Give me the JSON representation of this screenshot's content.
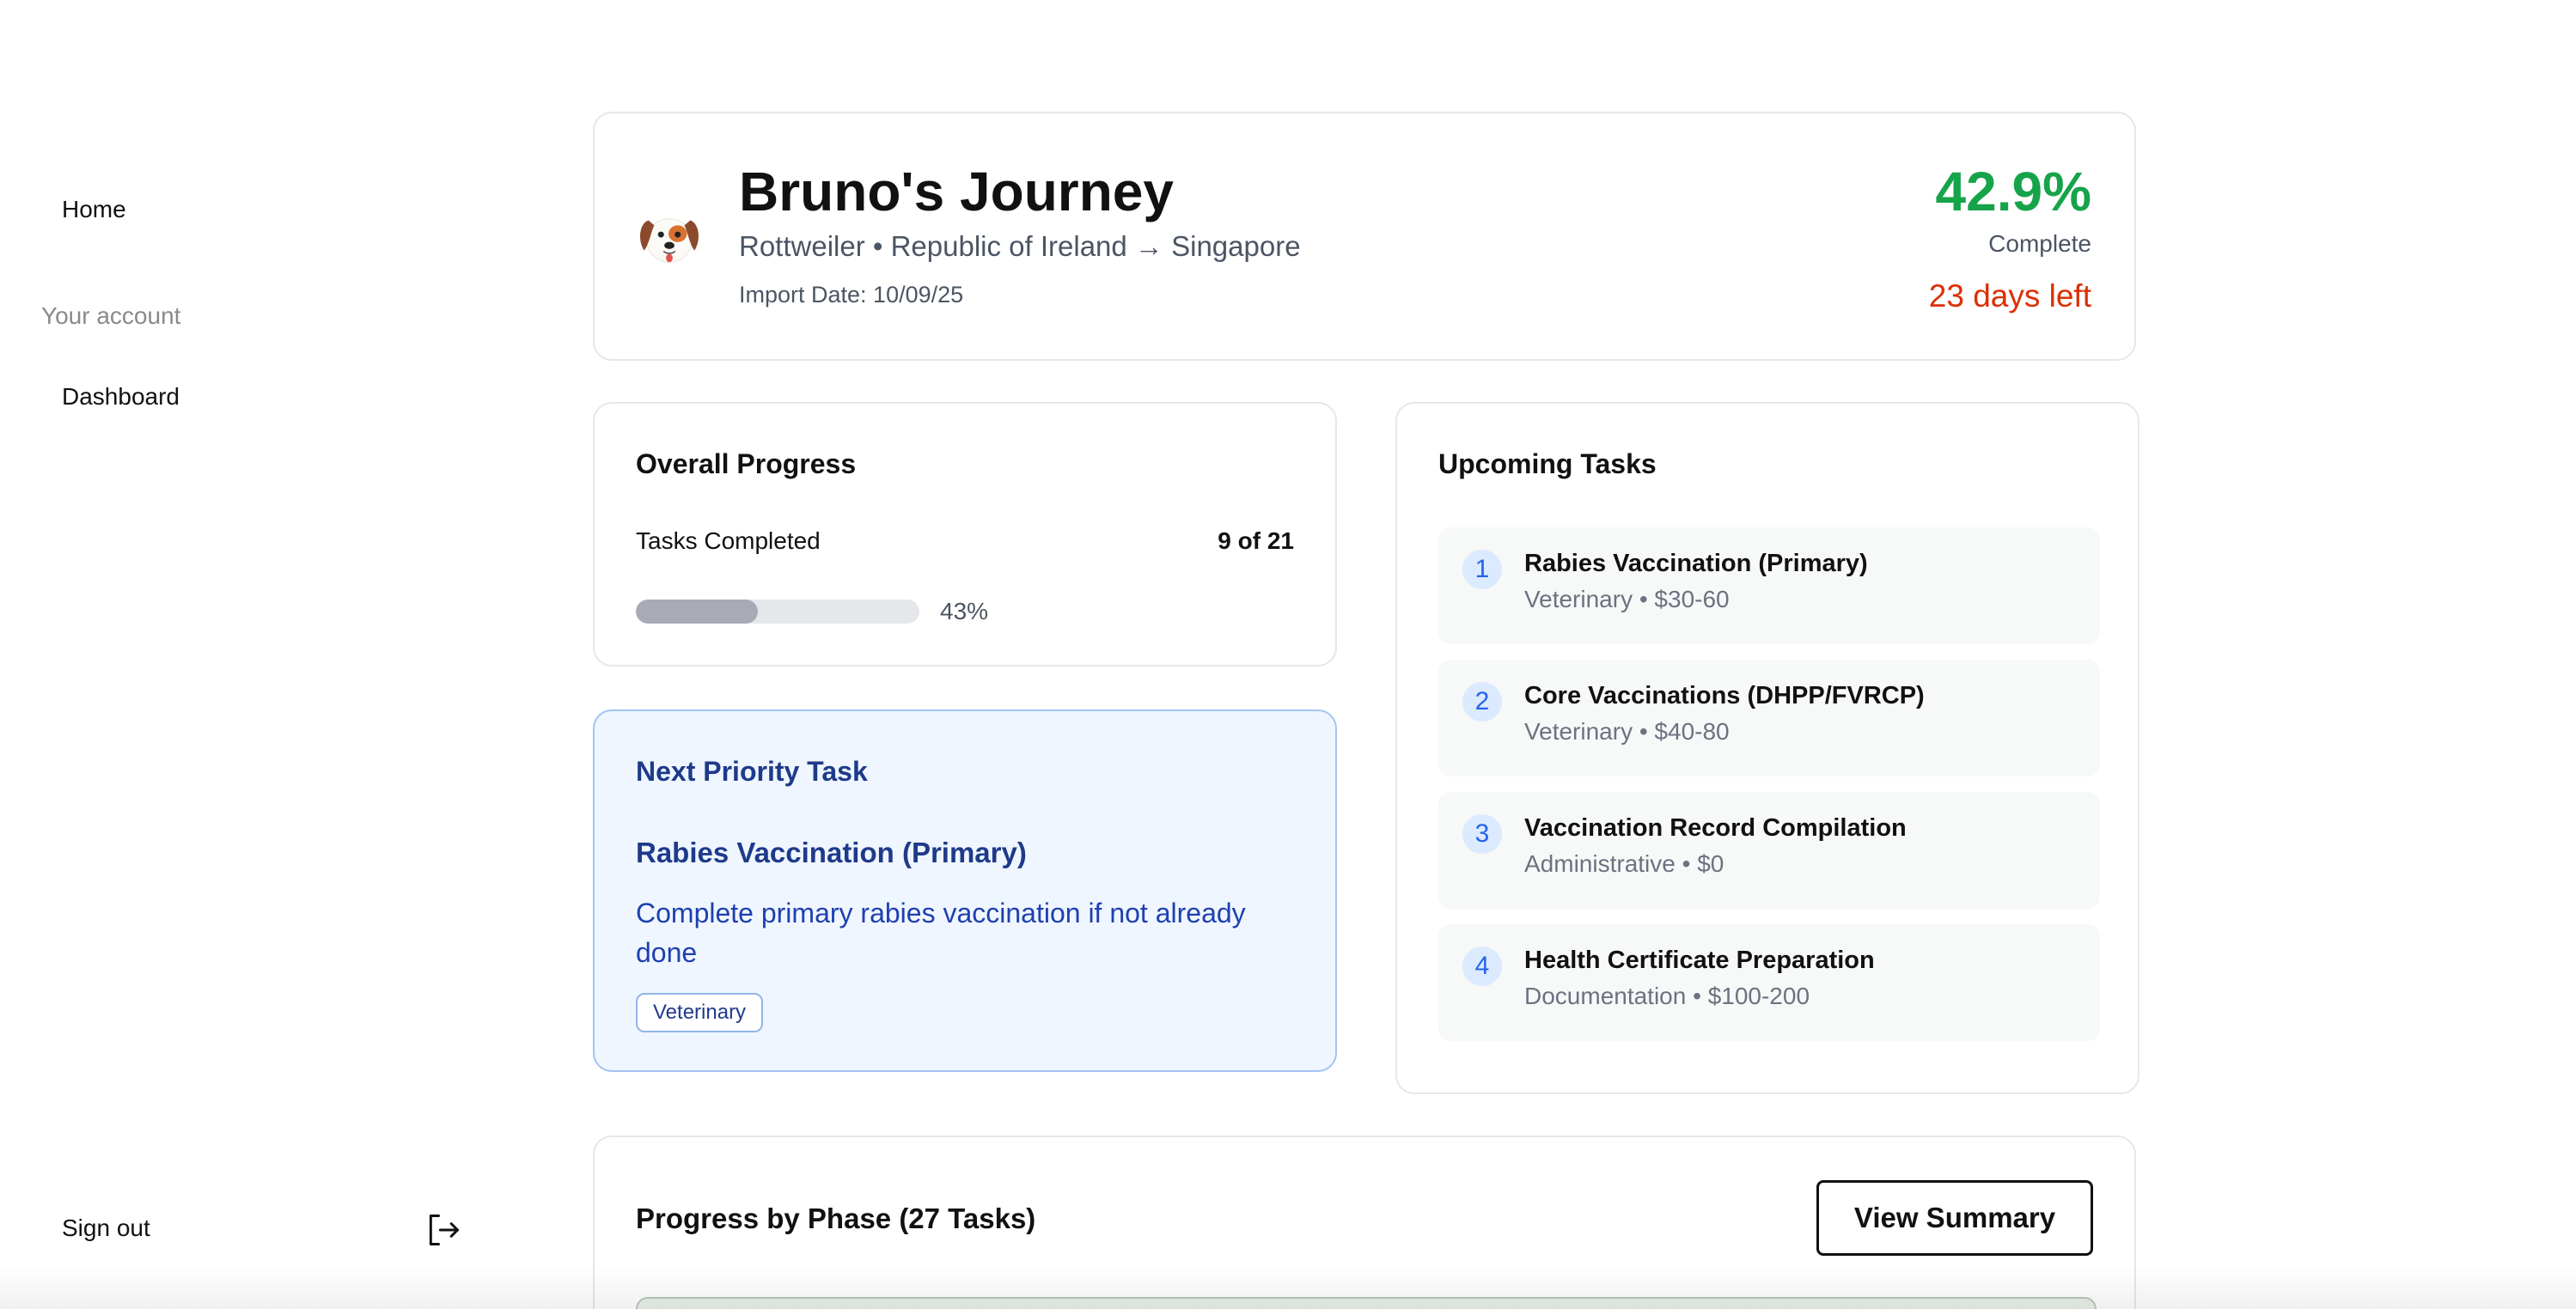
{
  "sidebar": {
    "home": "Home",
    "section_label": "Your account",
    "dashboard": "Dashboard",
    "sign_out": "Sign out"
  },
  "header": {
    "pet_name": "Bruno's Journey",
    "route": "Rottweiler • Republic of Ireland → Singapore",
    "import_date": "Import Date: 10/09/25",
    "percent_complete": "42.9%",
    "complete_label": "Complete",
    "days_left": "23 days left"
  },
  "overall_progress": {
    "title": "Overall Progress",
    "tasks_label": "Tasks Completed",
    "tasks_count": "9 of 21",
    "percent": 43,
    "percent_label": "43%"
  },
  "next_priority": {
    "title": "Next Priority Task",
    "task": "Rabies Vaccination (Primary)",
    "description": "Complete primary rabies vaccination if not already done",
    "tag": "Veterinary"
  },
  "upcoming": {
    "title": "Upcoming Tasks",
    "tasks": [
      {
        "num": "1",
        "title": "Rabies Vaccination (Primary)",
        "meta": "Veterinary • $30-60"
      },
      {
        "num": "2",
        "title": "Core Vaccinations (DHPP/FVRCP)",
        "meta": "Veterinary • $40-80"
      },
      {
        "num": "3",
        "title": "Vaccination Record Compilation",
        "meta": "Administrative • $0"
      },
      {
        "num": "4",
        "title": "Health Certificate Preparation",
        "meta": "Documentation • $100-200"
      }
    ]
  },
  "phases": {
    "title": "Progress by Phase (27 Tasks)",
    "view_summary": "View Summary"
  },
  "colors": {
    "success": "#16a34a",
    "warning": "#dc2f02",
    "priority_bg": "#eff6ff",
    "priority_text": "#1e3a8a"
  },
  "icons": {
    "pet": "dog-face-icon",
    "sign_out": "sign-out-icon"
  }
}
